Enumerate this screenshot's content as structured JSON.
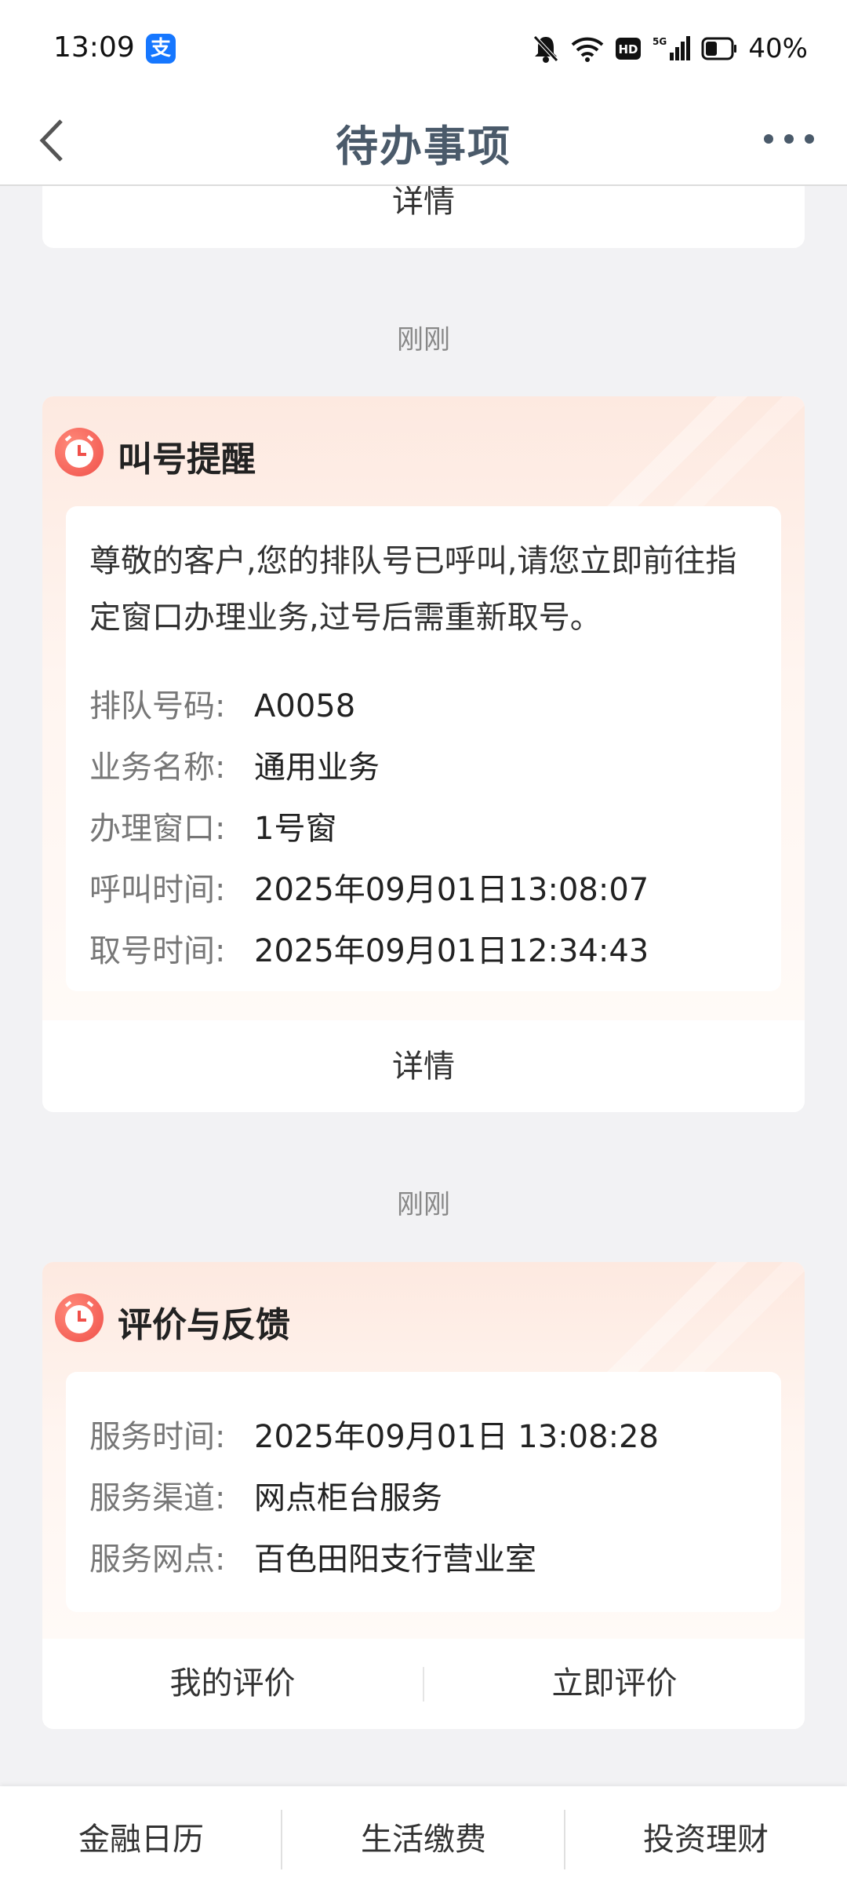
{
  "status_bar": {
    "time": "13:09",
    "alipay_badge": "支",
    "battery": "40%",
    "icons": [
      "bell-off-icon",
      "wifi-icon",
      "hd-icon",
      "5g-signal-icon",
      "battery-icon"
    ]
  },
  "header": {
    "title": "待办事项",
    "back_icon": "chevron-left-icon",
    "more_icon": "more-dots-icon"
  },
  "cards": [
    {
      "detail_label": "详情"
    },
    {
      "time_label": "刚刚",
      "title": "叫号提醒",
      "icon": "alarm-clock-icon",
      "message": "尊敬的客户,您的排队号已呼叫,请您立即前往指定窗口办理业务,过号后需重新取号。",
      "fields": [
        {
          "key": "排队号码:",
          "value": "A0058"
        },
        {
          "key": "业务名称:",
          "value": "通用业务"
        },
        {
          "key": "办理窗口:",
          "value": "1号窗"
        },
        {
          "key": "呼叫时间:",
          "value": "2025年09月01日13:08:07"
        },
        {
          "key": "取号时间:",
          "value": "2025年09月01日12:34:43"
        }
      ],
      "detail_label": "详情"
    },
    {
      "time_label": "刚刚",
      "title": "评价与反馈",
      "icon": "alarm-clock-icon",
      "fields": [
        {
          "key": "服务时间:",
          "value": "2025年09月01日 13:08:28"
        },
        {
          "key": "服务渠道:",
          "value": "网点柜台服务"
        },
        {
          "key": "服务网点:",
          "value": "百色田阳支行营业室"
        }
      ],
      "my_review_label": "我的评价",
      "review_now_label": "立即评价"
    }
  ],
  "bottom_nav": {
    "items": [
      "金融日历",
      "生活缴费",
      "投资理财"
    ]
  },
  "colors": {
    "accent_red": "#f0504a",
    "title_gray_blue": "#4a5a6a",
    "background": "#f2f2f4"
  }
}
